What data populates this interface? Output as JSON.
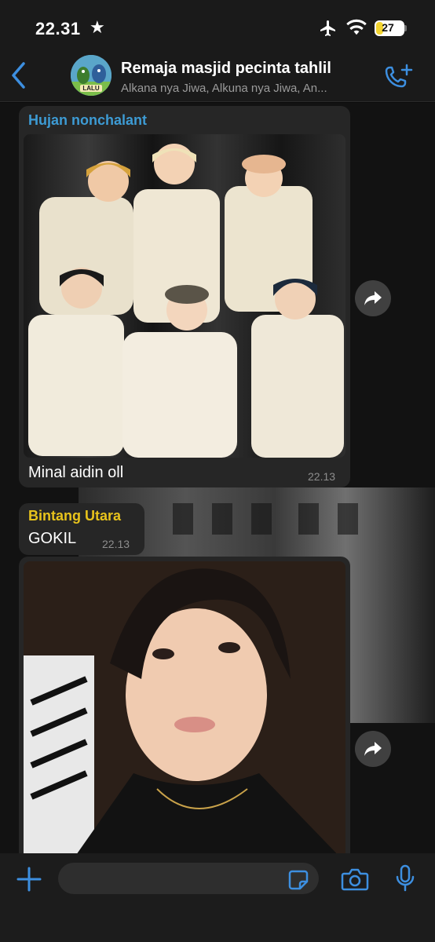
{
  "status_bar": {
    "time": "22.31",
    "star_icon": "★",
    "battery": "27",
    "battery_level_percent": 27
  },
  "header": {
    "title": "Remaja masjid pecinta tahlil",
    "members": "Alkana nya Jiwa, Alkuna nya Jiwa, An...",
    "avatar_label": "LALU"
  },
  "messages": [
    {
      "sender": "Hujan nonchalant",
      "sender_color": "#3d9bd4",
      "text": "Minal aidin oll",
      "time": "22.13"
    },
    {
      "sender": "Bintang Utara",
      "sender_color": "#e8c31c",
      "text": "GOKIL",
      "time": "22.13"
    }
  ],
  "composer": {
    "placeholder": ""
  },
  "colors": {
    "accent": "#3d8fe0",
    "bubble": "#262626",
    "background": "#121212"
  },
  "icons": {
    "back": "chevron-left-icon",
    "add_call": "phone-plus-icon",
    "forward": "forward-icon",
    "attach": "plus-icon",
    "sticker": "sticker-icon",
    "camera": "camera-icon",
    "mic": "microphone-icon"
  }
}
